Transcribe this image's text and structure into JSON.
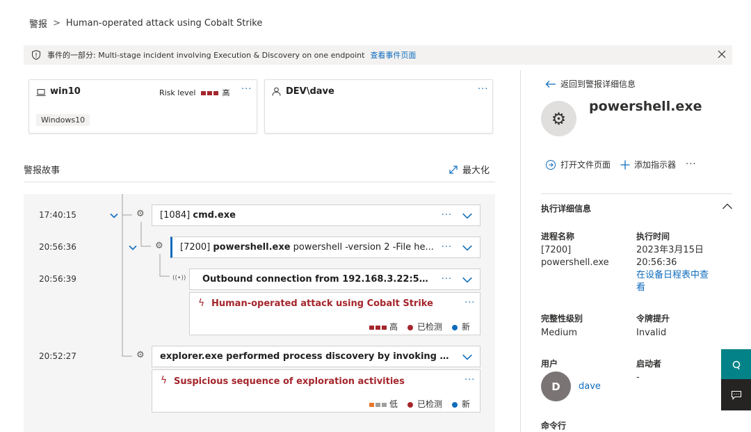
{
  "breadcrumb": {
    "root": "警报",
    "separator": ">",
    "current": "Human-operated attack using Cobalt Strike"
  },
  "banner": {
    "text": "事件的一部分: Multi-stage incident involving Execution & Discovery on one endpoint",
    "link": "查看事件页面"
  },
  "device_card": {
    "name": "win10",
    "risk_label": "Risk level",
    "risk_value": "高",
    "tag": "Windows10",
    "more": "···"
  },
  "user_card": {
    "name": "DEV\\dave",
    "more": "···"
  },
  "story": {
    "title": "警报故事",
    "maximize": "最大化",
    "nodes": [
      {
        "time": "17:40:15",
        "pid": "[1084]",
        "name": "cmd.exe",
        "detail": ""
      },
      {
        "time": "20:56:36",
        "pid": "[7200]",
        "name": "powershell.exe",
        "detail": "powershell -version 2 -File he..."
      },
      {
        "time": "20:56:39",
        "name": "Outbound connection from 192.168.3.22:50..."
      },
      {
        "time": "20:52:27",
        "name": "explorer.exe performed process discovery by invoking p..."
      }
    ],
    "alerts": [
      {
        "title": "Human-operated attack using Cobalt Strike",
        "severity": "高",
        "status": "已检测",
        "state": "新",
        "severity_color": "#a4262c"
      },
      {
        "title": "Suspicious sequence of exploration activities",
        "severity": "低",
        "status": "已检测",
        "state": "新",
        "severity_color": "#e8772e"
      }
    ],
    "more": "···"
  },
  "panel": {
    "back": "返回到警报详细信息",
    "title": "powershell.exe",
    "open_file": "打开文件页面",
    "add_indicator": "添加指示器",
    "more": "···",
    "section": "执行详细信息",
    "fields": {
      "process_name_label": "进程名称",
      "process_name_value": "[7200] powershell.exe",
      "exec_time_label": "执行时间",
      "exec_time_value": "2023年3月15日 20:56:36",
      "exec_time_link": "在设备日程表中查看",
      "integrity_label": "完整性级别",
      "integrity_value": "Medium",
      "token_label": "令牌提升",
      "token_value": "Invalid",
      "user_label": "用户",
      "user_avatar": "D",
      "user_value": "dave",
      "initiator_label": "启动者",
      "initiator_value": "-",
      "cmdline_label": "命令行"
    }
  },
  "colors": {
    "accent": "#0f6cbd",
    "alert": "#a4262c",
    "detected_dot": "#a4262c",
    "new_dot": "#0f6cbd",
    "fab_teal": "#038387",
    "fab_dark": "#252423"
  }
}
